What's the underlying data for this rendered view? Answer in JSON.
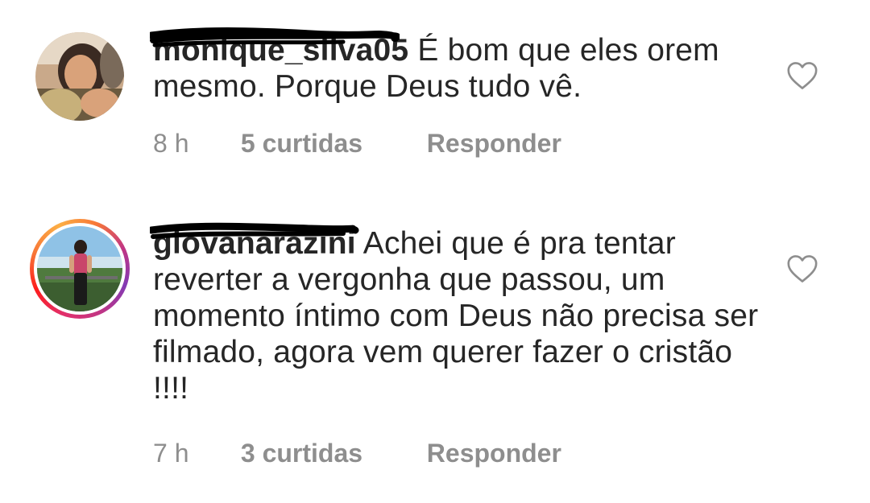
{
  "comments": [
    {
      "username": "monique_silva05",
      "text": "É bom que eles orem mesmo. Porque Deus tudo vê.",
      "time": "8 h",
      "likes": "5 curtidas",
      "reply": "Responder",
      "avatar_icon": "profile-photo",
      "like_icon": "heart-outline-icon"
    },
    {
      "username": "giovanarazini",
      "text": "Achei que é pra tentar reverter a vergonha que passou, um momento íntimo com Deus não precisa ser filmado, agora vem querer  fazer o cristão !!!!",
      "time": "7 h",
      "likes": "3 curtidas",
      "reply": "Responder",
      "avatar_icon": "profile-photo-with-story-ring",
      "like_icon": "heart-outline-icon"
    }
  ],
  "colors": {
    "text": "#262626",
    "meta": "#8e8e8e",
    "scribble": "#000000",
    "heart": "#8e8e8e"
  }
}
